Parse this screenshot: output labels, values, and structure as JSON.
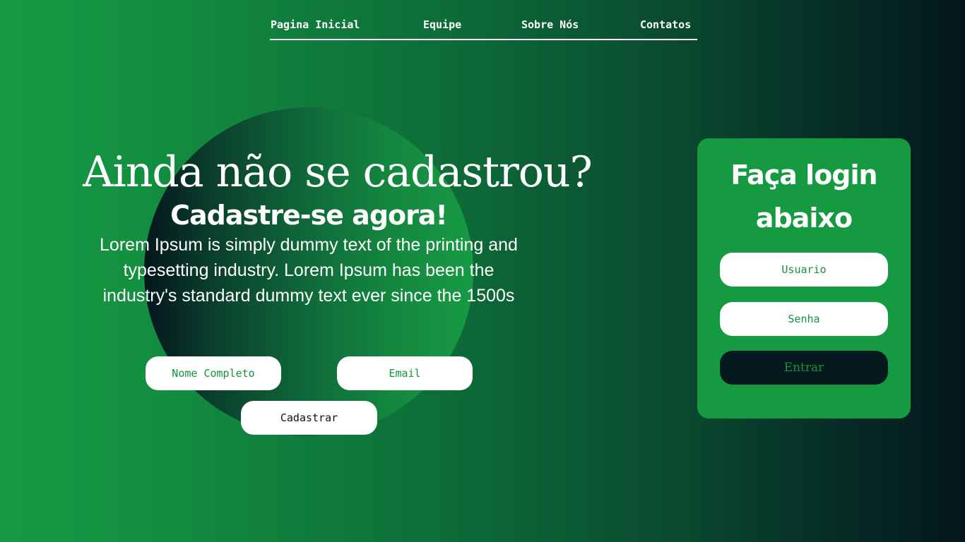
{
  "nav": {
    "items": [
      {
        "label": "Pagina Inicial"
      },
      {
        "label": "Equipe"
      },
      {
        "label": "Sobre Nós"
      },
      {
        "label": "Contatos"
      }
    ]
  },
  "hero": {
    "title": "Ainda não se cadastrou?",
    "subtitle": "Cadastre-se agora!",
    "description": "Lorem Ipsum is simply dummy text of the printing and typesetting industry. Lorem Ipsum has been the industry's standard dummy text ever since the 1500s"
  },
  "signup": {
    "name_placeholder": "Nome Completo",
    "email_placeholder": "Email",
    "submit_label": "Cadastrar"
  },
  "login": {
    "title": "Faça login abaixo",
    "user_placeholder": "Usuario",
    "password_placeholder": "Senha",
    "submit_label": "Entrar"
  },
  "colors": {
    "brand_green": "#169a41",
    "dark": "#04161d",
    "white": "#ffffff"
  }
}
